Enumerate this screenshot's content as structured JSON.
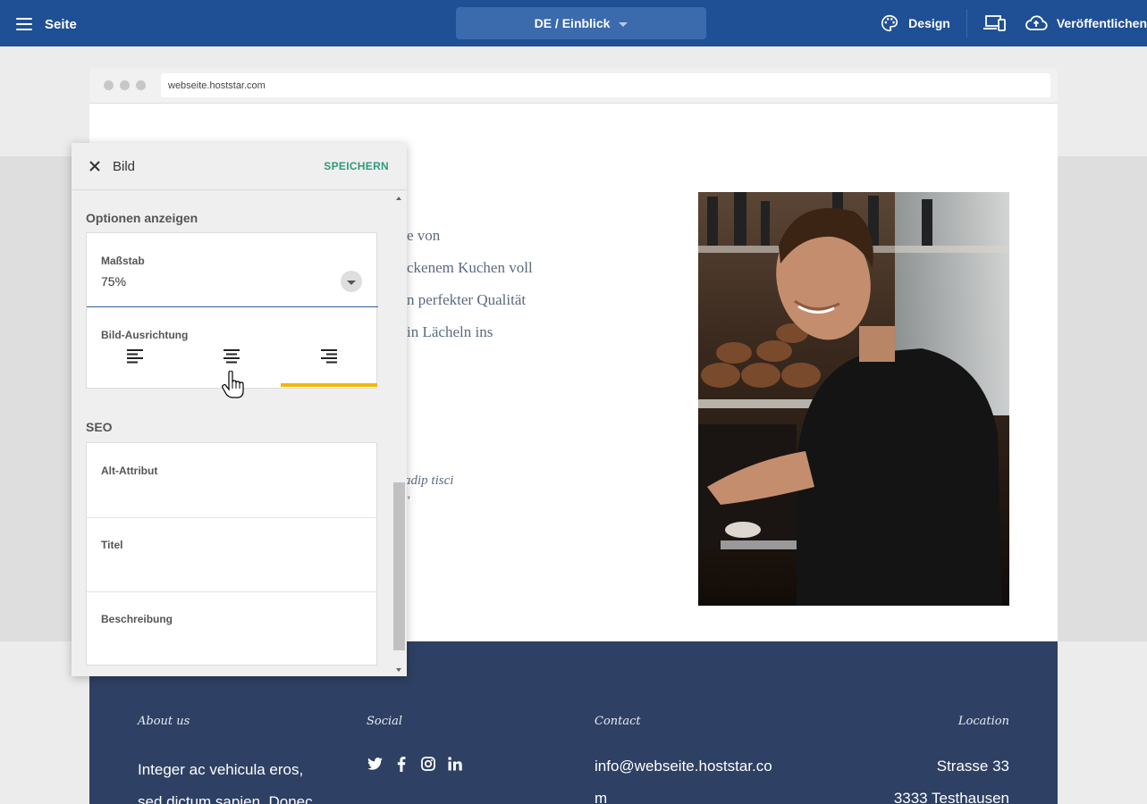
{
  "topbar": {
    "page_label": "Seite",
    "language_selector": "DE / Einblick",
    "design_label": "Design",
    "publish_label": "Veröffentlichen"
  },
  "browser": {
    "url": "webseite.hoststar.com"
  },
  "page": {
    "body_lines": [
      "e von",
      "ckenem Kuchen voll",
      "n perfekter Qualität",
      "in Lächeln ins"
    ],
    "quote_lines": [
      "adip tisci",
      "\""
    ]
  },
  "footer": {
    "about_heading": "About us",
    "about_lines": [
      "Integer ac vehicula eros,",
      "sed dictum sapien. Donec"
    ],
    "social_heading": "Social",
    "social_icons": [
      "twitter-icon",
      "facebook-icon",
      "instagram-icon",
      "linkedin-icon"
    ],
    "contact_heading": "Contact",
    "contact_lines": [
      "info@webseite.hoststar.co",
      "m"
    ],
    "location_heading": "Location",
    "location_lines": [
      "Strasse 33",
      "3333 Testhausen"
    ]
  },
  "panel": {
    "title": "Bild",
    "save_label": "SPEICHERN",
    "display_options_title": "Optionen anzeigen",
    "scale_label": "Maßstab",
    "scale_value": "75%",
    "alignment_label": "Bild-Ausrichtung",
    "alignment_selected": "right",
    "seo_title": "SEO",
    "alt_label": "Alt-Attribut",
    "title_label": "Titel",
    "description_label": "Beschreibung"
  },
  "colors": {
    "topbar": "#1f4f95",
    "accent_save": "#2e9b7b",
    "active_align": "#f2b705",
    "footer": "#2e4063"
  }
}
